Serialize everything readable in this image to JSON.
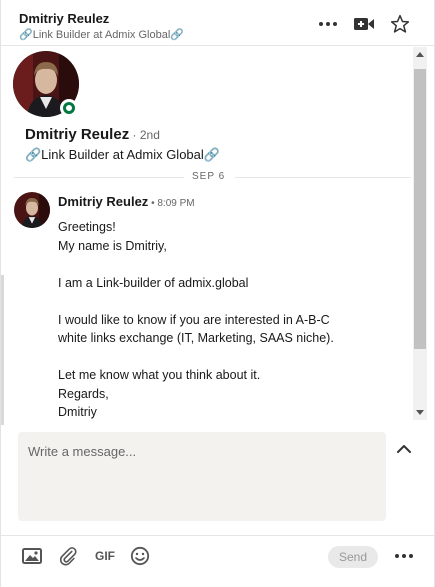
{
  "header": {
    "name": "Dmitriy Reulez",
    "headline": "🔗Link Builder at Admix Global🔗"
  },
  "profile": {
    "name": "Dmitriy Reulez",
    "degree": " · 2nd",
    "headline": "🔗Link Builder at Admix Global🔗"
  },
  "thread": {
    "date_divider": "SEP 6",
    "message": {
      "sender": "Dmitriy Reulez",
      "time": " • 8:09 PM",
      "lines": [
        "Greetings!",
        "My name is Dmitriy,",
        "",
        "I am a Link-builder of admix.global",
        "",
        "I would like to know if you are interested in A-B-C",
        "white links exchange (IT, Marketing, SAAS niche).",
        "",
        "Let me know what you think about it.",
        "Regards,",
        "Dmitriy"
      ]
    }
  },
  "compose": {
    "placeholder": "Write a message...",
    "gif_label": "GIF",
    "send_label": "Send"
  },
  "colors": {
    "presence": "#057642",
    "compose_bg": "#f3f2ef"
  },
  "icons": [
    "more-icon",
    "video-call-icon",
    "star-icon",
    "image-icon",
    "attachment-icon",
    "emoji-icon",
    "chevron-up-icon"
  ]
}
